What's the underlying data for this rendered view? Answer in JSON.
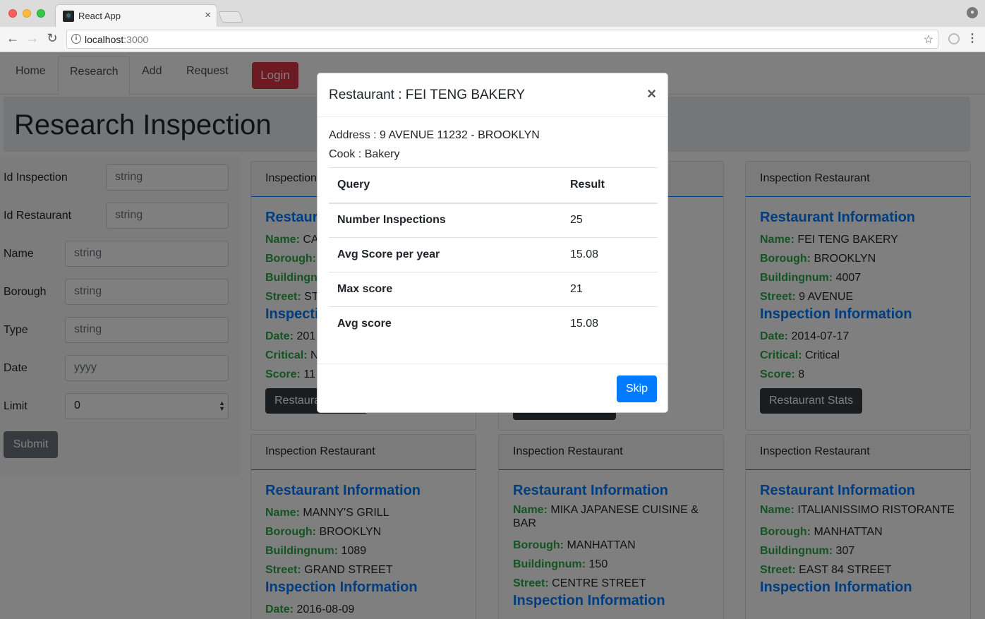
{
  "browser": {
    "tab_title": "React App",
    "tab_close": "×",
    "url_host": "localhost",
    "url_port": ":3000"
  },
  "nav": {
    "home": "Home",
    "research": "Research",
    "add": "Add",
    "request": "Request",
    "login": "Login"
  },
  "page_title": "Research Inspection",
  "form": {
    "id_inspection": {
      "label": "Id Inspection",
      "value": "string"
    },
    "id_restaurant": {
      "label": "Id Restaurant",
      "value": "string"
    },
    "name": {
      "label": "Name",
      "value": "string"
    },
    "borough": {
      "label": "Borough",
      "value": "string"
    },
    "type": {
      "label": "Type",
      "value": "string"
    },
    "date": {
      "label": "Date",
      "value": "yyyy"
    },
    "limit": {
      "label": "Limit",
      "value": "0"
    },
    "submit": "Submit"
  },
  "cards": [
    {
      "header": "Inspection Restaurant",
      "restaurant_title": "Restaurant Information",
      "name_label": "Name:",
      "name": "CA",
      "borough_label": "Borough:",
      "borough": "",
      "building_label": "Buildingnum:",
      "building": "",
      "street_label": "Street:",
      "street": "ST",
      "inspection_title": "Inspection Information",
      "date_label": "Date:",
      "date": "201",
      "critical_label": "Critical:",
      "critical": "N",
      "score_label": "Score:",
      "score": "11",
      "button": "Restaurant Stats"
    },
    {
      "header": "Inspection Restaurant",
      "restaurant_title": "Restaurant Information",
      "name_label": "Name:",
      "name": "FEI TENG BAKERY",
      "borough_label": "Borough:",
      "borough": "BROOKLYN",
      "building_label": "Buildingnum:",
      "building": "4007",
      "street_label": "Street:",
      "street": "9 AVENUE",
      "inspection_title": "Inspection Information",
      "date_label": "Date:",
      "date": "2014-07-17",
      "critical_label": "Critical:",
      "critical": "Critical",
      "score_label": "Score:",
      "score": "8",
      "button": "Restaurant Stats"
    },
    {
      "header": "Inspection Restaurant",
      "restaurant_title": "Restaurant Information",
      "name_label": "Name:",
      "name": "MANNY'S GRILL",
      "borough_label": "Borough:",
      "borough": "BROOKLYN",
      "building_label": "Buildingnum:",
      "building": "1089",
      "street_label": "Street:",
      "street": "GRAND STREET",
      "inspection_title": "Inspection Information",
      "date_label": "Date:",
      "date": "2016-08-09"
    },
    {
      "header": "Inspection Restaurant",
      "restaurant_title": "Restaurant Information",
      "name_label": "Name:",
      "name": "MIKA JAPANESE CUISINE & BAR",
      "borough_label": "Borough:",
      "borough": "MANHATTAN",
      "building_label": "Buildingnum:",
      "building": "150",
      "street_label": "Street:",
      "street": "CENTRE STREET",
      "inspection_title": "Inspection Information"
    },
    {
      "header": "Inspection Restaurant",
      "restaurant_title": "Restaurant Information",
      "name_label": "Name:",
      "name": "ITALIANISSIMO RISTORANTE",
      "borough_label": "Borough:",
      "borough": "MANHATTAN",
      "building_label": "Buildingnum:",
      "building": "307",
      "street_label": "Street:",
      "street": "EAST 84 STREET",
      "inspection_title": "Inspection Information"
    }
  ],
  "modal": {
    "title": "Restaurant : FEI TENG BAKERY",
    "close": "×",
    "address": "Address : 9 AVENUE 11232 - BROOKLYN",
    "cook": "Cook : Bakery",
    "columns": [
      "Query",
      "Result"
    ],
    "rows": [
      {
        "query": "Number Inspections",
        "result": "25"
      },
      {
        "query": "Avg Score per year",
        "result": "15.08"
      },
      {
        "query": "Max score",
        "result": "21"
      },
      {
        "query": "Avg score",
        "result": "15.08"
      }
    ],
    "skip": "Skip"
  },
  "colors": {
    "primary": "#007bff",
    "danger": "#dc3545",
    "success": "#28a745",
    "secondary": "#6c757d",
    "dark": "#343a40"
  }
}
